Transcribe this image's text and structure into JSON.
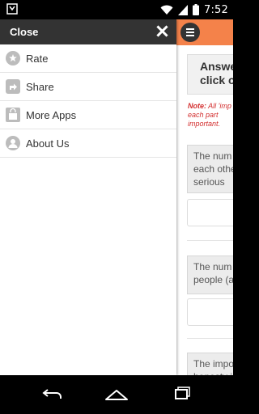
{
  "status_bar": {
    "time": "7:52"
  },
  "drawer": {
    "title": "Close",
    "items": [
      {
        "label": "Rate",
        "icon": "star-icon"
      },
      {
        "label": "Share",
        "icon": "share-icon"
      },
      {
        "label": "More Apps",
        "icon": "bag-icon"
      },
      {
        "label": "About Us",
        "icon": "person-icon"
      }
    ]
  },
  "content": {
    "instruction": "Answe click o",
    "note_prefix": "Note:",
    "note_text": "All 'imp for each part important.",
    "questions": [
      {
        "text": "The num each othe serious"
      },
      {
        "text": "The num people (a"
      },
      {
        "text": "The impo honesty i"
      }
    ]
  },
  "colors": {
    "accent": "#f4824a",
    "drawer_header": "#333333",
    "note_red": "#d32f2f"
  }
}
